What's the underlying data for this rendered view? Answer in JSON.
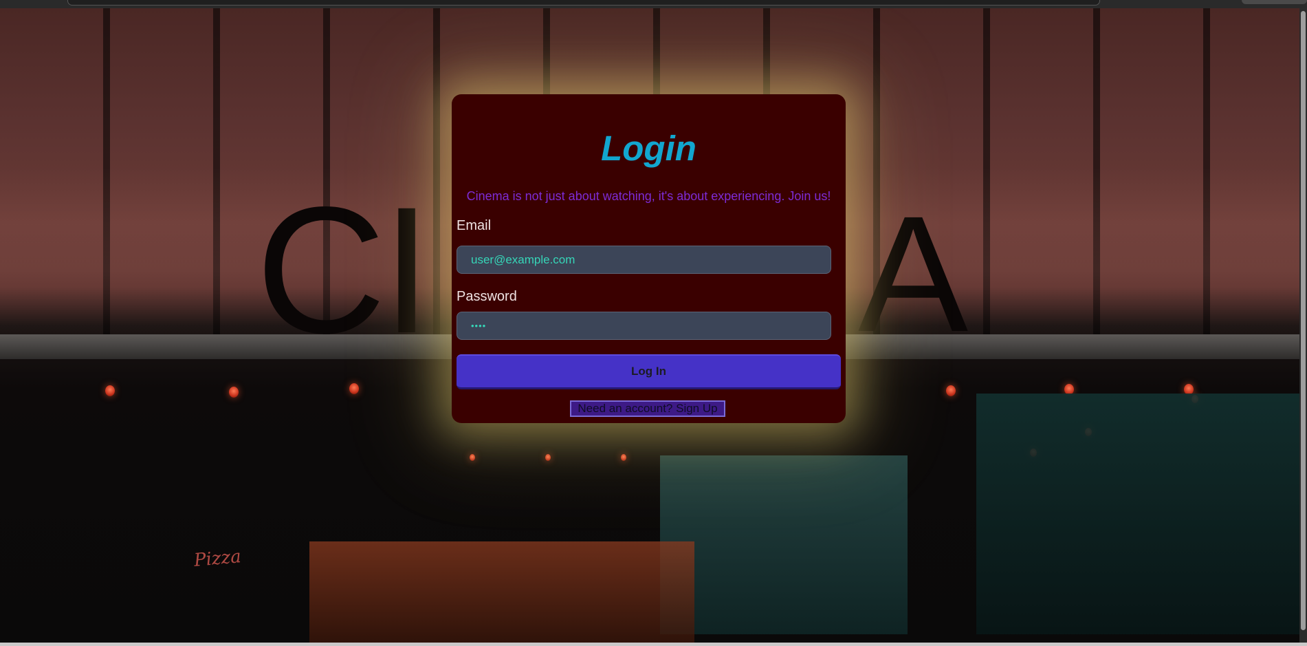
{
  "login": {
    "title": "Login",
    "tagline": "Cinema is not just about watching, it's about experiencing. Join us!",
    "email_label": "Email",
    "email_value": "user@example.com",
    "password_label": "Password",
    "password_value": "••••",
    "submit_label": "Log In",
    "signup_label": "Need an account? Sign Up"
  },
  "background": {
    "sign_letters_left": "CI",
    "sign_letters_right": "A",
    "neon_sign": "Pizza"
  },
  "colors": {
    "card_background": "#3a0000",
    "card_glow": "#e4cc6e",
    "title": "#12a6cf",
    "tagline": "#7d2bd6",
    "input_background": "#3c4558",
    "input_text": "#36d6b8",
    "button": "#4532c7"
  }
}
